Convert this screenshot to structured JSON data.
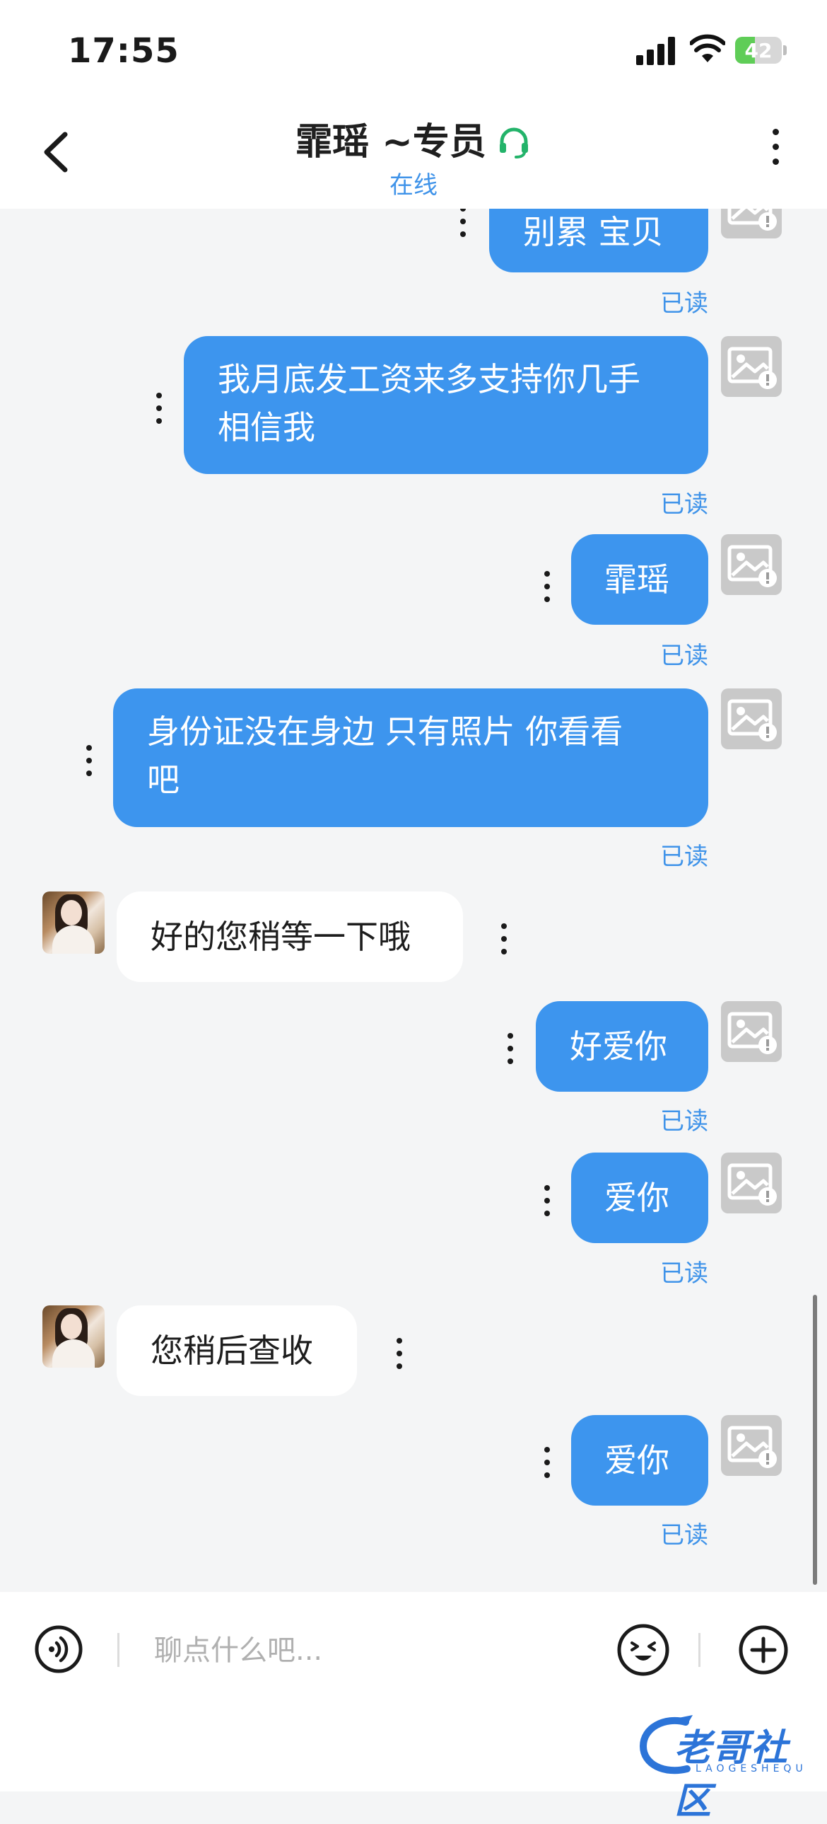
{
  "status_bar": {
    "time": "17:55",
    "battery_level": "42",
    "battery_fraction": 0.42
  },
  "header": {
    "title": "霏瑶 ~专员",
    "status": "在线",
    "headset_icon_color": "#23b36a"
  },
  "messages": [
    {
      "side": "out",
      "text": "别累 宝贝",
      "read": "已读"
    },
    {
      "side": "out",
      "text_line1": "我月底发工资来多支持你几手",
      "text_line2": "相信我",
      "read": "已读"
    },
    {
      "side": "out",
      "text": "霏瑶",
      "read": "已读"
    },
    {
      "side": "out",
      "text_line1": "身份证没在身边 只有照片 你看看",
      "text_line2": "吧",
      "read": "已读"
    },
    {
      "side": "in",
      "text": "好的您稍等一下哦"
    },
    {
      "side": "out",
      "text": "好爱你",
      "read": "已读"
    },
    {
      "side": "out",
      "text": "爱你",
      "read": "已读"
    },
    {
      "side": "in",
      "text": "您稍后查收"
    },
    {
      "side": "out",
      "text": "爱你",
      "read": "已读"
    }
  ],
  "input_bar": {
    "placeholder": "聊点什么吧..."
  },
  "watermark": {
    "text": "老哥社区",
    "subtext": "LAOGESHEQU"
  },
  "colors": {
    "outgoing_bubble": "#3d95ee",
    "incoming_bubble": "#ffffff",
    "read_text": "#3f93e9",
    "background": "#f4f5f6"
  }
}
